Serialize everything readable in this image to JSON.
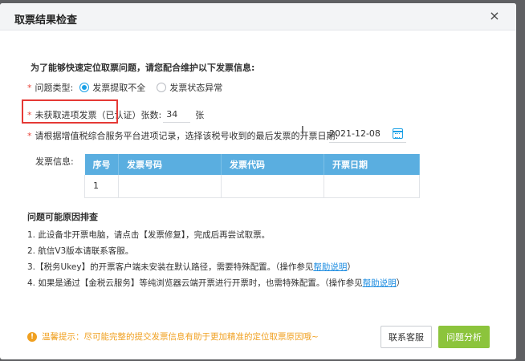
{
  "dialog": {
    "title": "取票结果检查",
    "close_label": "×",
    "intro": "为了能够快速定位取票问题，请您配合维护以下发票信息:"
  },
  "form": {
    "required_mark": "*",
    "problem_type_label": "问题类型:",
    "problem_options": [
      {
        "label": "发票提取不全",
        "selected": true
      },
      {
        "label": "发票状态异常",
        "selected": false
      }
    ],
    "unfetched_label": "未获取进项发票（已认证）张数:",
    "unfetched_count": "34",
    "unfetched_unit": "张",
    "date_prompt": "请根据增值税综合服务平台进项记录，选择该税号收到的最后发票的开票日期:",
    "date_value": "2021-12-08",
    "invoice_info_label": "发票信息:"
  },
  "invoice_table": {
    "headers": [
      "序号",
      "发票号码",
      "发票代码",
      "开票日期"
    ],
    "rows": [
      [
        "1",
        "",
        "",
        ""
      ]
    ]
  },
  "troubleshoot": {
    "title": "问题可能原因排查",
    "items": [
      {
        "text": "1. 此设备非开票电脑，请点击【发票修复】，完成后再尝试取票。"
      },
      {
        "text": "2. 航信V3版本请联系客服。"
      },
      {
        "text": "3.【税务Ukey】的开票客户端未安装在默认路径，需要特殊配置。（操作参见",
        "link": "帮助说明",
        "suffix": "）"
      },
      {
        "text": "4. 如果是通过【金税云服务】等纯浏览器云端开票进行开票时，也需特殊配置。（操作参见",
        "link": "帮助说明",
        "suffix": "）"
      }
    ]
  },
  "footer": {
    "tip": "温馨提示：尽可能完整的提交发票信息有助于更加精准的定位取票原因哦~",
    "contact_button": "联系客服",
    "analyze_button": "问题分析"
  },
  "colors": {
    "accent": "#1aa0e6",
    "table_header": "#5aaee0",
    "primary_button": "#8cc43c",
    "warning": "#f0a020",
    "required": "#e8473c",
    "highlight_box": "#e53935"
  }
}
